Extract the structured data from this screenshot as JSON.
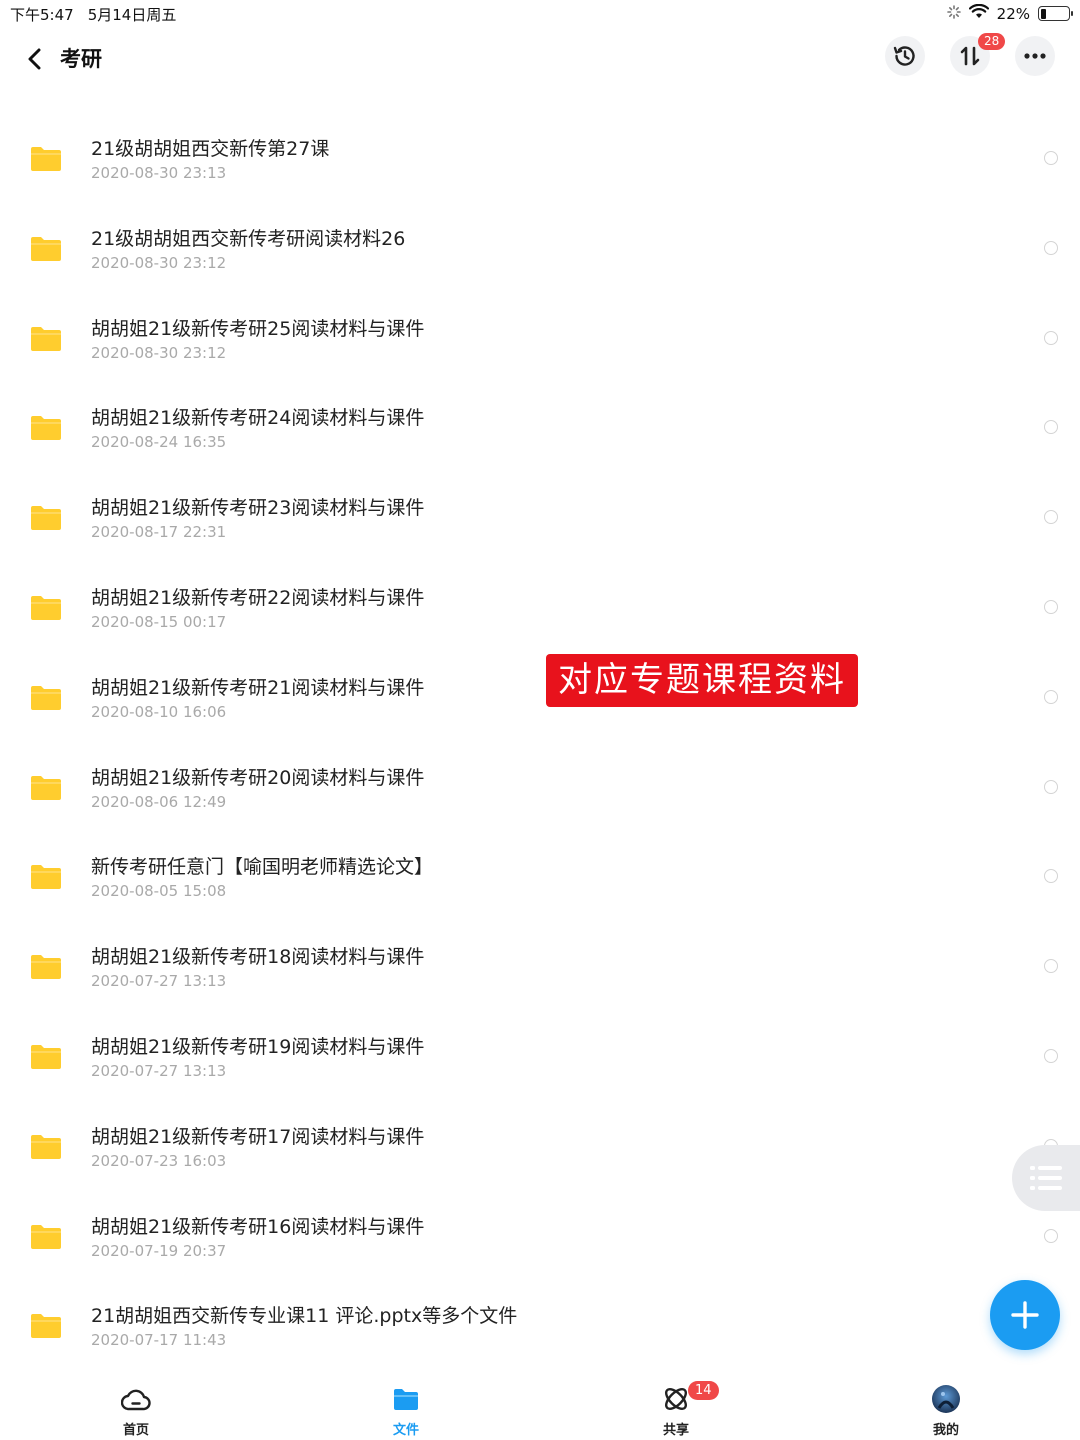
{
  "status_bar": {
    "time": "下午5:47",
    "date": "5月14日周五",
    "battery": "22%",
    "battery_level": 0.22
  },
  "header": {
    "title": "考研",
    "transfer_badge": "28"
  },
  "files": [
    {
      "name": "21级胡胡姐西交新传第27课",
      "date": "2020-08-30 23:13"
    },
    {
      "name": "21级胡胡姐西交新传考研阅读材料26",
      "date": "2020-08-30 23:12"
    },
    {
      "name": "胡胡姐21级新传考研25阅读材料与课件",
      "date": "2020-08-30 23:12"
    },
    {
      "name": "胡胡姐21级新传考研24阅读材料与课件",
      "date": "2020-08-24 16:35"
    },
    {
      "name": "胡胡姐21级新传考研23阅读材料与课件",
      "date": "2020-08-17 22:31"
    },
    {
      "name": "胡胡姐21级新传考研22阅读材料与课件",
      "date": "2020-08-15 00:17"
    },
    {
      "name": "胡胡姐21级新传考研21阅读材料与课件",
      "date": "2020-08-10 16:06"
    },
    {
      "name": "胡胡姐21级新传考研20阅读材料与课件",
      "date": "2020-08-06 12:49"
    },
    {
      "name": "新传考研任意门【喻国明老师精选论文】",
      "date": "2020-08-05 15:08"
    },
    {
      "name": "胡胡姐21级新传考研18阅读材料与课件",
      "date": "2020-07-27 13:13"
    },
    {
      "name": "胡胡姐21级新传考研19阅读材料与课件",
      "date": "2020-07-27 13:13"
    },
    {
      "name": "胡胡姐21级新传考研17阅读材料与课件",
      "date": "2020-07-23 16:03"
    },
    {
      "name": "胡胡姐21级新传考研16阅读材料与课件",
      "date": "2020-07-19 20:37"
    },
    {
      "name": "21胡胡姐西交新传专业课11  评论.pptx等多个文件",
      "date": "2020-07-17 11:43"
    }
  ],
  "overlay_label": "对应专题课程资料",
  "tabs": [
    {
      "label": "首页",
      "icon": "cloud-home-icon",
      "active": false
    },
    {
      "label": "文件",
      "icon": "folder-icon",
      "active": true
    },
    {
      "label": "共享",
      "icon": "share-orbit-icon",
      "active": false,
      "badge": "14"
    },
    {
      "label": "我的",
      "icon": "avatar",
      "active": false
    }
  ],
  "colors": {
    "accent": "#1b9cf2",
    "folder": "#ffcd2e",
    "badge": "#f04848",
    "overlay": "#e8121c"
  }
}
